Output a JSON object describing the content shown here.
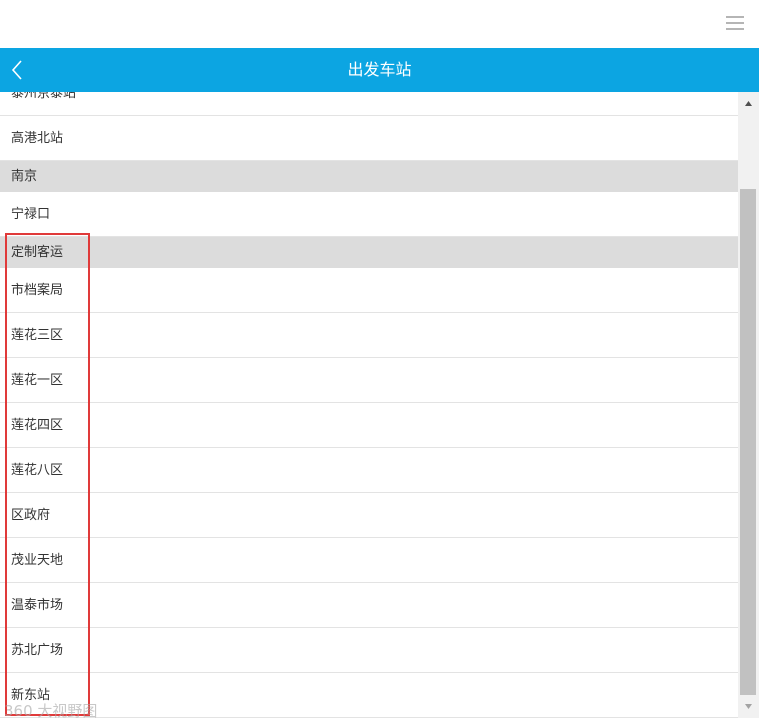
{
  "header": {
    "title": "出发车站"
  },
  "list": {
    "rows": [
      {
        "type": "item",
        "label": "泰州京泰站"
      },
      {
        "type": "item",
        "label": "高港北站"
      },
      {
        "type": "group",
        "label": "南京"
      },
      {
        "type": "item",
        "label": "宁禄口"
      },
      {
        "type": "group",
        "label": "定制客运"
      },
      {
        "type": "item",
        "label": "市档案局"
      },
      {
        "type": "item",
        "label": "莲花三区"
      },
      {
        "type": "item",
        "label": "莲花一区"
      },
      {
        "type": "item",
        "label": "莲花四区"
      },
      {
        "type": "item",
        "label": "莲花八区"
      },
      {
        "type": "item",
        "label": "区政府"
      },
      {
        "type": "item",
        "label": "茂业天地"
      },
      {
        "type": "item",
        "label": "温泰市场"
      },
      {
        "type": "item",
        "label": "苏北广场"
      },
      {
        "type": "item",
        "label": "新东站"
      }
    ]
  },
  "watermark": {
    "text": "360 大视野图"
  },
  "colors": {
    "header_bg": "#0ca5e2",
    "group_bg": "#dcdcdc",
    "highlight": "#e03a3a"
  },
  "icons": {
    "menu": "hamburger-icon",
    "back": "chevron-left-icon",
    "scroll_up": "arrow-up-icon",
    "scroll_down": "arrow-down-icon"
  }
}
